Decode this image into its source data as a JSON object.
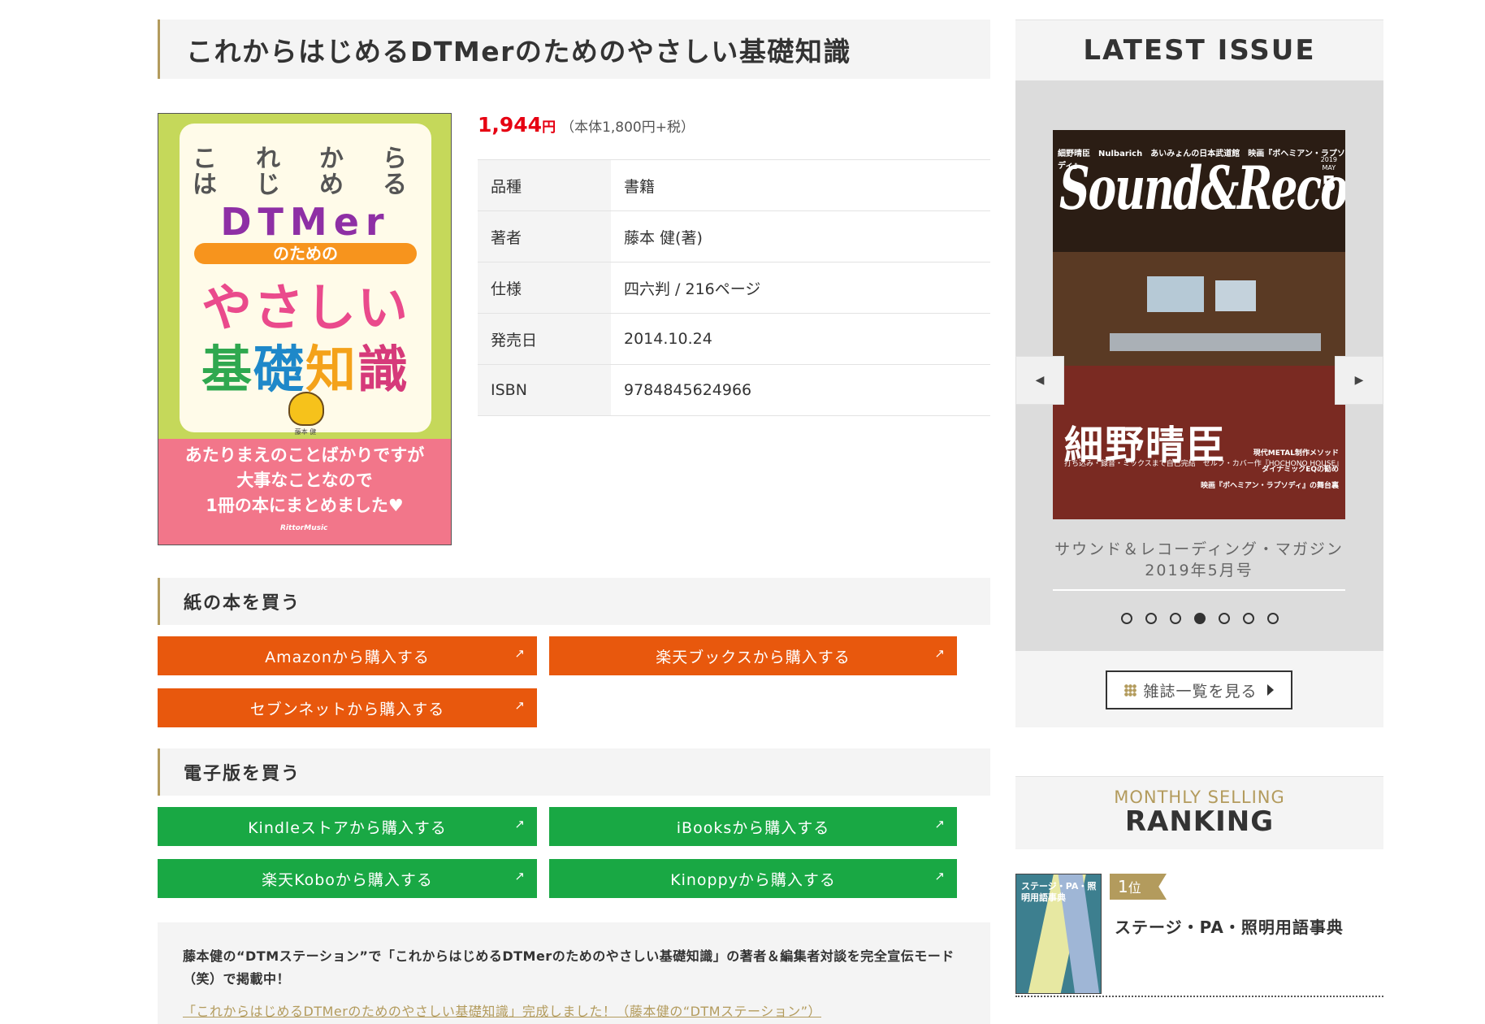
{
  "product": {
    "title": "これからはじめるDTMerのためのやさしい基礎知識",
    "price_value": "1,944",
    "price_yen": "円",
    "price_detail": "（本体1,800円+税）",
    "specs": [
      {
        "label": "品種",
        "value": "書籍"
      },
      {
        "label": "著者",
        "value": "藤本 健(著)"
      },
      {
        "label": "仕様",
        "value": "四六判 / 216ページ"
      },
      {
        "label": "発売日",
        "value": "2014.10.24"
      },
      {
        "label": "ISBN",
        "value": "9784845624966"
      }
    ]
  },
  "cover": {
    "kana_row1": [
      "こ",
      "れ",
      "か",
      "ら"
    ],
    "kana_row2": [
      "は",
      "じ",
      "め",
      "る"
    ],
    "dtmer": "DTMer",
    "nonotameno": "のための",
    "yasashii": "やさしい",
    "kiso": [
      "基",
      "礎",
      "知",
      "識"
    ],
    "author": "藤本 健",
    "tagline": [
      "あたりまえのことばかりですが",
      "大事なことなので",
      "1冊の本にまとめました♥"
    ],
    "publisher": "RittorMusic",
    "colors": {
      "frame": "#c5d85a",
      "bottom": "#f2768a"
    }
  },
  "paper": {
    "heading": "紙の本を買う",
    "buttons": [
      "Amazonから購入する",
      "楽天ブックスから購入する",
      "セブンネットから購入する"
    ]
  },
  "ebook": {
    "heading": "電子版を買う",
    "buttons": [
      "Kindleストアから購入する",
      "iBooksから購入する",
      "楽天Koboから購入する",
      "Kinoppyから購入する"
    ]
  },
  "note": {
    "text": "藤本健の“DTMステーション”で「これからはじめるDTMerのためのやさしい基礎知識」の著者＆編集者対談を完全宣伝モード（笑）で掲載中！",
    "link": "「これからはじめるDTMerのためのやさしい基礎知識」完成しました！（藤本健の“DTMステーション”）"
  },
  "latest": {
    "heading": "LATEST ISSUE",
    "prev_icon": "chevron-left-icon",
    "next_icon": "chevron-right-icon",
    "magazine": {
      "top_line": "細野晴臣　Nulbarich　あいみょんの日本武道館　映画『ボヘミアン・ラプソディ』",
      "logo": "Sound&Recording",
      "year": "2019",
      "month_label": "MAY",
      "month": "5",
      "cover_name": "細野晴臣",
      "cover_sub": "打ち込み・録音・ミックスまで自己完結　セルフ・カバー作『HOCHONO HOUSE』",
      "cover_right": [
        "現代METAL制作メソッド",
        "ダイナミックEQの勧め",
        "映画『ボヘミアン・ラプソディ』の舞台裏"
      ]
    },
    "caption": "サウンド＆レコーディング・マガジン 2019年5月号",
    "dots": 7,
    "active_dot": 3,
    "list_button": "雑誌一覧を見る"
  },
  "ranking": {
    "small": "MONTHLY SELLING",
    "big": "RANKING",
    "items": [
      {
        "rank": "1",
        "rank_suffix": "位",
        "title": "ステージ・PA・照明用語事典",
        "cover_text": "ステージ・PA・照明用語事典"
      }
    ]
  },
  "colors": {
    "accent": "#b39b5d",
    "orange": "#e8580d",
    "green": "#19a844",
    "price_red": "#e60012"
  }
}
